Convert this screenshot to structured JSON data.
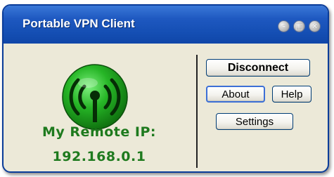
{
  "window": {
    "title": "Portable VPN Client",
    "controls": {
      "minimize": "–",
      "maximize": "□",
      "close": "✕"
    }
  },
  "status": {
    "label": "My Remote IP:",
    "ip": "192.168.0.1",
    "icon": "wifi-signal-icon",
    "color": "#1e7a1e"
  },
  "buttons": {
    "disconnect": "Disconnect",
    "about": "About",
    "help": "Help",
    "settings": "Settings"
  },
  "colors": {
    "titlebar": "#1e58c0",
    "accent_green": "#22a422",
    "body": "#ece9d8"
  }
}
